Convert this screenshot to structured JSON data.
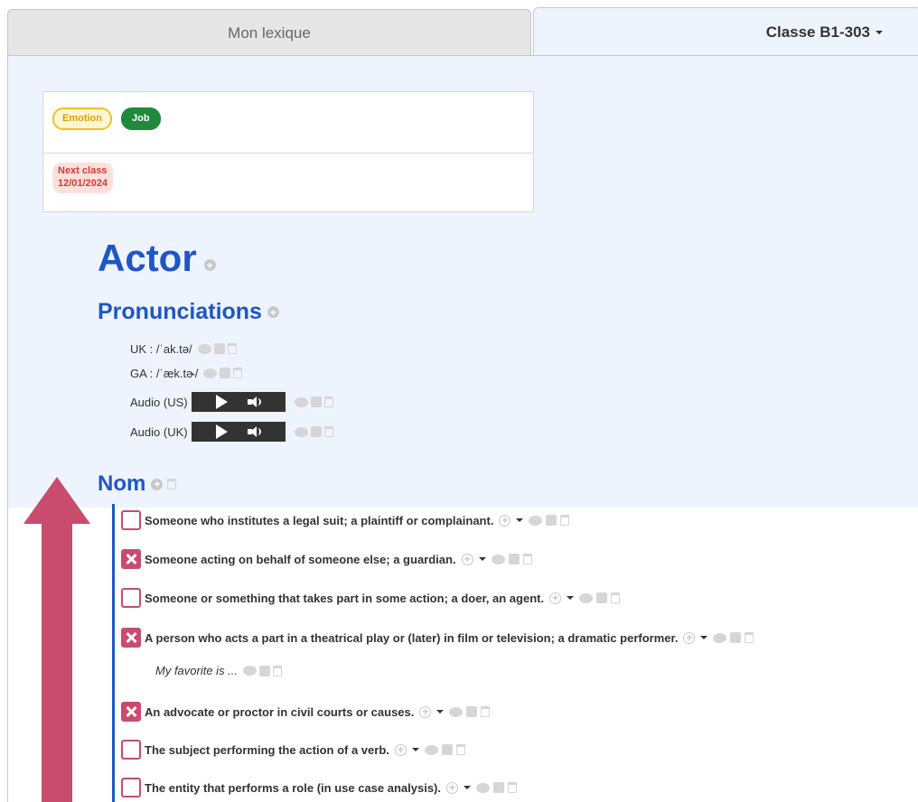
{
  "tabs": {
    "my_lexicon": "Mon lexique",
    "class": "Classe B1-303"
  },
  "card": {
    "tags": [
      "Emotion",
      "Job"
    ],
    "next_class_label": "Next class",
    "next_class_date": "12/01/2024"
  },
  "word": {
    "title": "Actor",
    "pronunciations_heading": "Pronunciations",
    "pronunciations": [
      {
        "label": "UK : /ˈak.tə/"
      },
      {
        "label": "GA : /ˈæk.tɚ/"
      }
    ],
    "audio": [
      {
        "label": "Audio (US)"
      },
      {
        "label": "Audio (UK)"
      }
    ],
    "pos_heading": "Nom",
    "definitions": [
      {
        "text": "Someone who institutes a legal suit; a plaintiff or complainant.",
        "checked": false
      },
      {
        "text": "Someone acting on behalf of someone else; a guardian.",
        "checked": true
      },
      {
        "text": "Someone or something that takes part in some action; a doer, an agent.",
        "checked": false
      },
      {
        "text": "A person who acts a part in a theatrical play or (later) in film or television; a dramatic performer.",
        "checked": true
      },
      {
        "text": "An advocate or proctor in civil courts or causes.",
        "checked": true
      },
      {
        "text": "The subject performing the action of a verb.",
        "checked": false
      },
      {
        "text": "The entity that performs a role (in use case analysis).",
        "checked": false
      }
    ],
    "example": "My favorite is ..."
  },
  "colors": {
    "accent_blue": "#1e56c6",
    "checkbox_pink": "#c94b6d",
    "panel_bg": "#eef4fd",
    "tag_emotion": "#f2c21b",
    "tag_job": "#1f8a3a",
    "next_class": "#d83a2e"
  }
}
